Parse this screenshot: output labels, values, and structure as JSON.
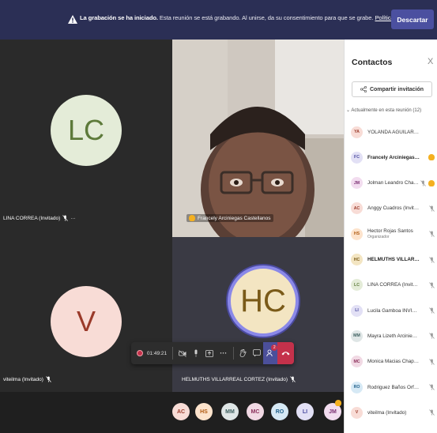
{
  "banner": {
    "bold_text": "La grabación se ha iniciado.",
    "text": " Esta reunión se está grabando. Al unirse, da su consentimiento para que se grabe. ",
    "link": "Política de privacidad",
    "dismiss_label": "Descartar"
  },
  "tiles": {
    "lc": {
      "initials": "LC",
      "name": "LINA CORREA (Invitado)",
      "more": "···"
    },
    "fc": {
      "name": "Francely Arciniegas Castellanos"
    },
    "v": {
      "initials": "V",
      "name": "viteilma (Invitado)"
    },
    "hc": {
      "initials": "HC",
      "name": "HELMUTHS VILLARREAL CORTEZ (Invitado)"
    }
  },
  "controls": {
    "timer": "01:49:21",
    "participants_count": "2"
  },
  "strip": [
    {
      "initials": "AC",
      "bg": "#f8dcd6",
      "fg": "#9a3a2a"
    },
    {
      "initials": "HS",
      "bg": "#fde3cc",
      "fg": "#b05a10"
    },
    {
      "initials": "MM",
      "bg": "#dfe6e6",
      "fg": "#3d5f5f"
    },
    {
      "initials": "MC",
      "bg": "#f1d9e4",
      "fg": "#8a2f5a"
    },
    {
      "initials": "RO",
      "bg": "#d6e9f5",
      "fg": "#1f5f8a"
    },
    {
      "initials": "LI",
      "bg": "#e2e0f5",
      "fg": "#4b4ba0"
    },
    {
      "initials": "JM",
      "bg": "#f2dcef",
      "fg": "#7a2f72"
    }
  ],
  "sidebar": {
    "title": "Contactos",
    "close": "X",
    "share_label": "Compartir invitación",
    "section": "Actualmente en esta reunión (12)",
    "people": [
      {
        "initials": "YA",
        "name": "YOLANDA AGUILAR - PERSONERI...",
        "role": "",
        "bold": false,
        "bg": "#f8dcd6",
        "fg": "#9a3a2a",
        "hand": false,
        "mic": false
      },
      {
        "initials": "FC",
        "name": "Francely Arciniegas Caste...",
        "role": "",
        "bold": true,
        "bg": "#e2e0f5",
        "fg": "#4b4ba0",
        "hand": true,
        "mic": false
      },
      {
        "initials": "JM",
        "name": "Jolman Leandro Chav...",
        "role": "",
        "bold": false,
        "bg": "#f2dcef",
        "fg": "#7a2f72",
        "hand": true,
        "mic": true
      },
      {
        "initials": "AC",
        "name": "Anggy Cuadros (Invitado)",
        "role": "",
        "bold": false,
        "bg": "#f8dcd6",
        "fg": "#9a3a2a",
        "hand": false,
        "mic": true
      },
      {
        "initials": "HS",
        "name": "Hector Rojas Santos",
        "role": "Organizador",
        "bold": false,
        "bg": "#fde3cc",
        "fg": "#b05a10",
        "hand": false,
        "mic": true
      },
      {
        "initials": "HC",
        "name": "HELMUTHS VILLARREAL C...",
        "role": "",
        "bold": true,
        "bg": "#f3e5c2",
        "fg": "#7a5a18",
        "hand": false,
        "mic": true
      },
      {
        "initials": "LC",
        "name": "LINA CORREA (Invitado)",
        "role": "",
        "bold": false,
        "bg": "#e4ecd8",
        "fg": "#5d7a3a",
        "hand": false,
        "mic": true
      },
      {
        "initials": "LI",
        "name": "Lucila Gamboa INVISBU (Invi...",
        "role": "",
        "bold": false,
        "bg": "#e2e0f5",
        "fg": "#4b4ba0",
        "hand": false,
        "mic": true
      },
      {
        "initials": "MM",
        "name": "Mayra Lizeth Arciniegas Mos...",
        "role": "",
        "bold": false,
        "bg": "#dfe6e6",
        "fg": "#3d5f5f",
        "hand": false,
        "mic": true
      },
      {
        "initials": "MC",
        "name": "Monica Macias Chaparro",
        "role": "",
        "bold": false,
        "bg": "#f1d9e4",
        "fg": "#8a2f5a",
        "hand": false,
        "mic": true
      },
      {
        "initials": "RO",
        "name": "Rodriguez Baños Orfelina",
        "role": "",
        "bold": false,
        "bg": "#d6e9f5",
        "fg": "#1f5f8a",
        "hand": false,
        "mic": true
      },
      {
        "initials": "V",
        "name": "viteilma (Invitado)",
        "role": "",
        "bold": false,
        "bg": "#f8dcd6",
        "fg": "#9a3a2a",
        "hand": false,
        "mic": true
      }
    ]
  }
}
